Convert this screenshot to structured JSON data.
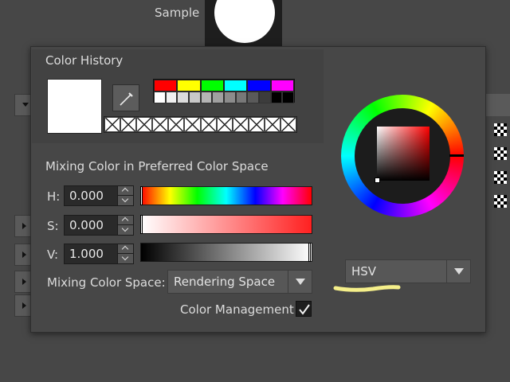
{
  "background": {
    "sample_label": "Sample"
  },
  "color_history": {
    "title": "Color History",
    "current_color": "#ffffff",
    "picker_icon": "eyedropper-icon",
    "palette_top": [
      "#ff0000",
      "#ffff00",
      "#00ff00",
      "#00ffff",
      "#0000ff",
      "#ff00ff"
    ],
    "palette_grays": [
      "#ffffff",
      "#f0f0f0",
      "#dcdcdc",
      "#c8c8c8",
      "#b4b4b4",
      "#a0a0a0",
      "#8c8c8c",
      "#787878",
      "#5a5a5a",
      "#3c3c3c",
      "#000000",
      "#000000"
    ],
    "history_slots": 12
  },
  "mixing": {
    "title": "Mixing Color in Preferred Color Space",
    "channels": [
      {
        "label": "H:",
        "value": "0.000",
        "level": 0.0
      },
      {
        "label": "S:",
        "value": "0.000",
        "level": 0.0
      },
      {
        "label": "V:",
        "value": "1.000",
        "level": 1.0
      }
    ],
    "color_space_label": "Mixing Color Space:",
    "color_space_value": "Rendering Space",
    "color_management_label": "Color Management",
    "color_management_checked": true
  },
  "wheel": {
    "mode_value": "HSV",
    "highlight_color": "#f5ef8a"
  }
}
